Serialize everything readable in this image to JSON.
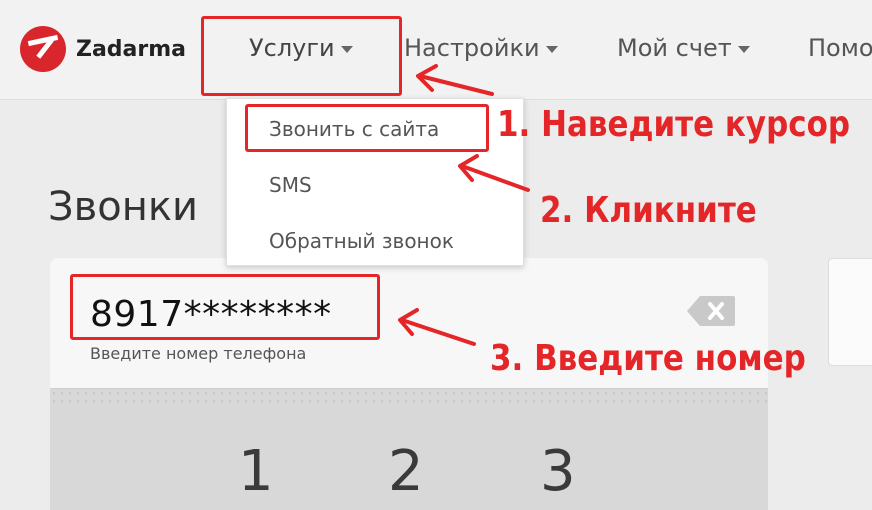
{
  "header": {
    "logo_text": "Zadarma",
    "nav": [
      {
        "label": "Услуги"
      },
      {
        "label": "Настройки"
      },
      {
        "label": "Мой счет"
      },
      {
        "label": "Помо"
      }
    ]
  },
  "dropdown": {
    "items": [
      {
        "label": "Звонить с сайта"
      },
      {
        "label": "SMS"
      },
      {
        "label": "Обратный звонок"
      }
    ]
  },
  "page": {
    "title": "Звонки"
  },
  "dialer": {
    "phone_value": "8917********",
    "hint": "Введите номер телефона",
    "keys": [
      "1",
      "2",
      "3"
    ]
  },
  "annotations": {
    "steps": [
      "1. Наведите курсор",
      "2. Кликните",
      "3. Введите номер"
    ],
    "highlight_color": "#e42628"
  },
  "icons": {
    "logo": "zadarma-logo-icon",
    "backspace": "backspace-icon",
    "caret": "chevron-down-icon"
  }
}
